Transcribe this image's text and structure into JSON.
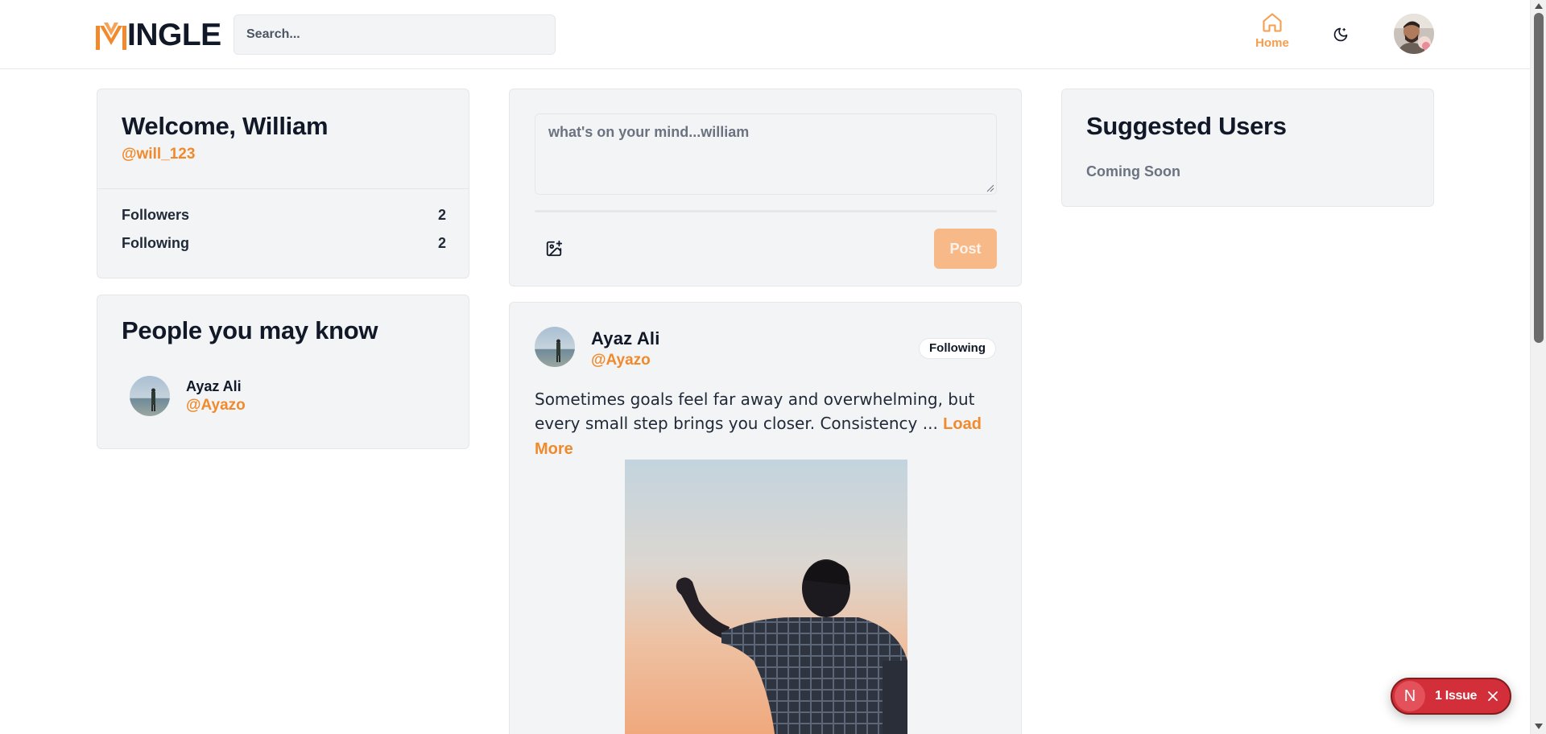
{
  "app": {
    "logo_text": "INGLE",
    "logo_letter": "M",
    "brand_color": "#f08a2c"
  },
  "header": {
    "search_placeholder": "Search...",
    "nav_home_label": "Home",
    "icons": {
      "home": "home-icon",
      "theme": "moon-icon",
      "avatar": "user-avatar"
    }
  },
  "welcome": {
    "title": "Welcome, William",
    "handle": "@will_123",
    "stats": [
      {
        "label": "Followers",
        "value": "2"
      },
      {
        "label": "Following",
        "value": "2"
      }
    ]
  },
  "people": {
    "title": "People you may know",
    "items": [
      {
        "name": "Ayaz Ali",
        "handle": "@Ayazo"
      }
    ]
  },
  "composer": {
    "placeholder": "what's on your mind...william",
    "post_label": "Post",
    "image_icon": "image-plus-icon"
  },
  "post": {
    "author_name": "Ayaz Ali",
    "author_handle": "@Ayazo",
    "follow_status": "Following",
    "text": "Sometimes goals feel far away and overwhelming, but every small step brings you closer. Consistency ...",
    "load_more": "Load More"
  },
  "suggested": {
    "title": "Suggested Users",
    "subtitle": "Coming Soon"
  },
  "dev_overlay": {
    "logo_letter": "N",
    "issue_label": "1 Issue"
  }
}
